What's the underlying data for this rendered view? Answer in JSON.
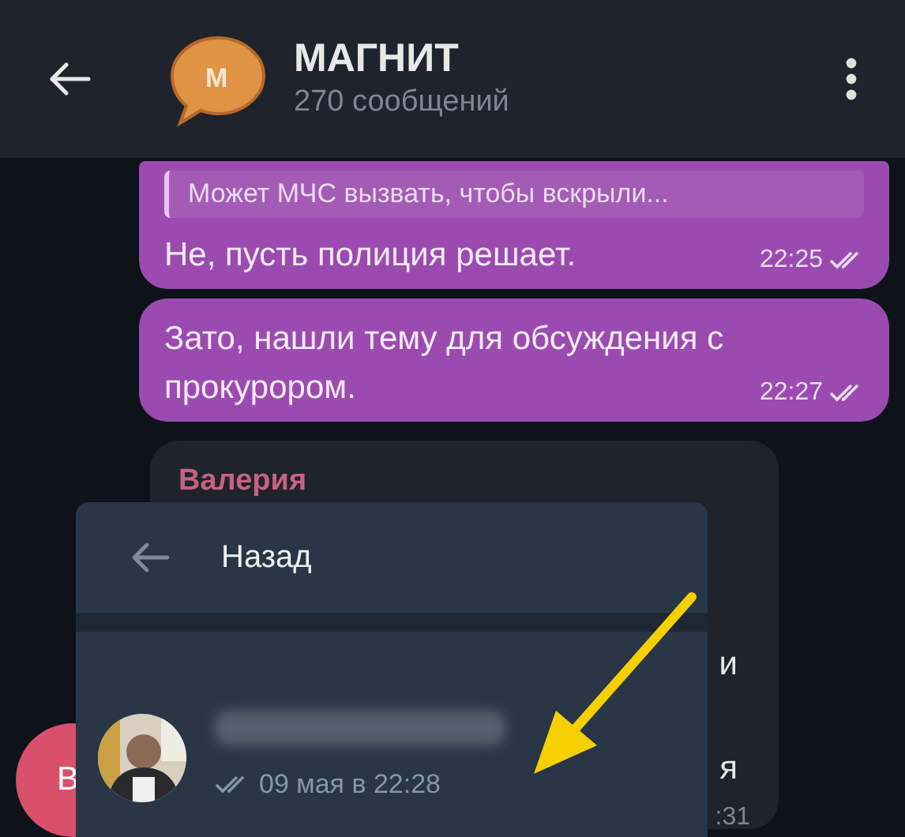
{
  "header": {
    "title": "МАГНИТ",
    "subtitle": "270 сообщений",
    "avatar_letter": "М"
  },
  "messages": [
    {
      "kind": "outgoing",
      "reply_quote": "Может МЧС вызвать, чтобы вскрыли...",
      "text": "Не, пусть полиция решает.",
      "time": "22:25",
      "read": true
    },
    {
      "kind": "outgoing",
      "text": "Зато, нашли тему для обсуждения с прокурором.",
      "time": "22:27",
      "read": true
    },
    {
      "kind": "incoming",
      "sender": "Валерия",
      "fragments": [
        "и",
        "я"
      ],
      "time": ":31"
    }
  ],
  "sender_avatar": {
    "letter": "В"
  },
  "popup": {
    "back_label": "Назад",
    "viewer": {
      "date": "09 мая в 22:28",
      "read": true
    }
  }
}
